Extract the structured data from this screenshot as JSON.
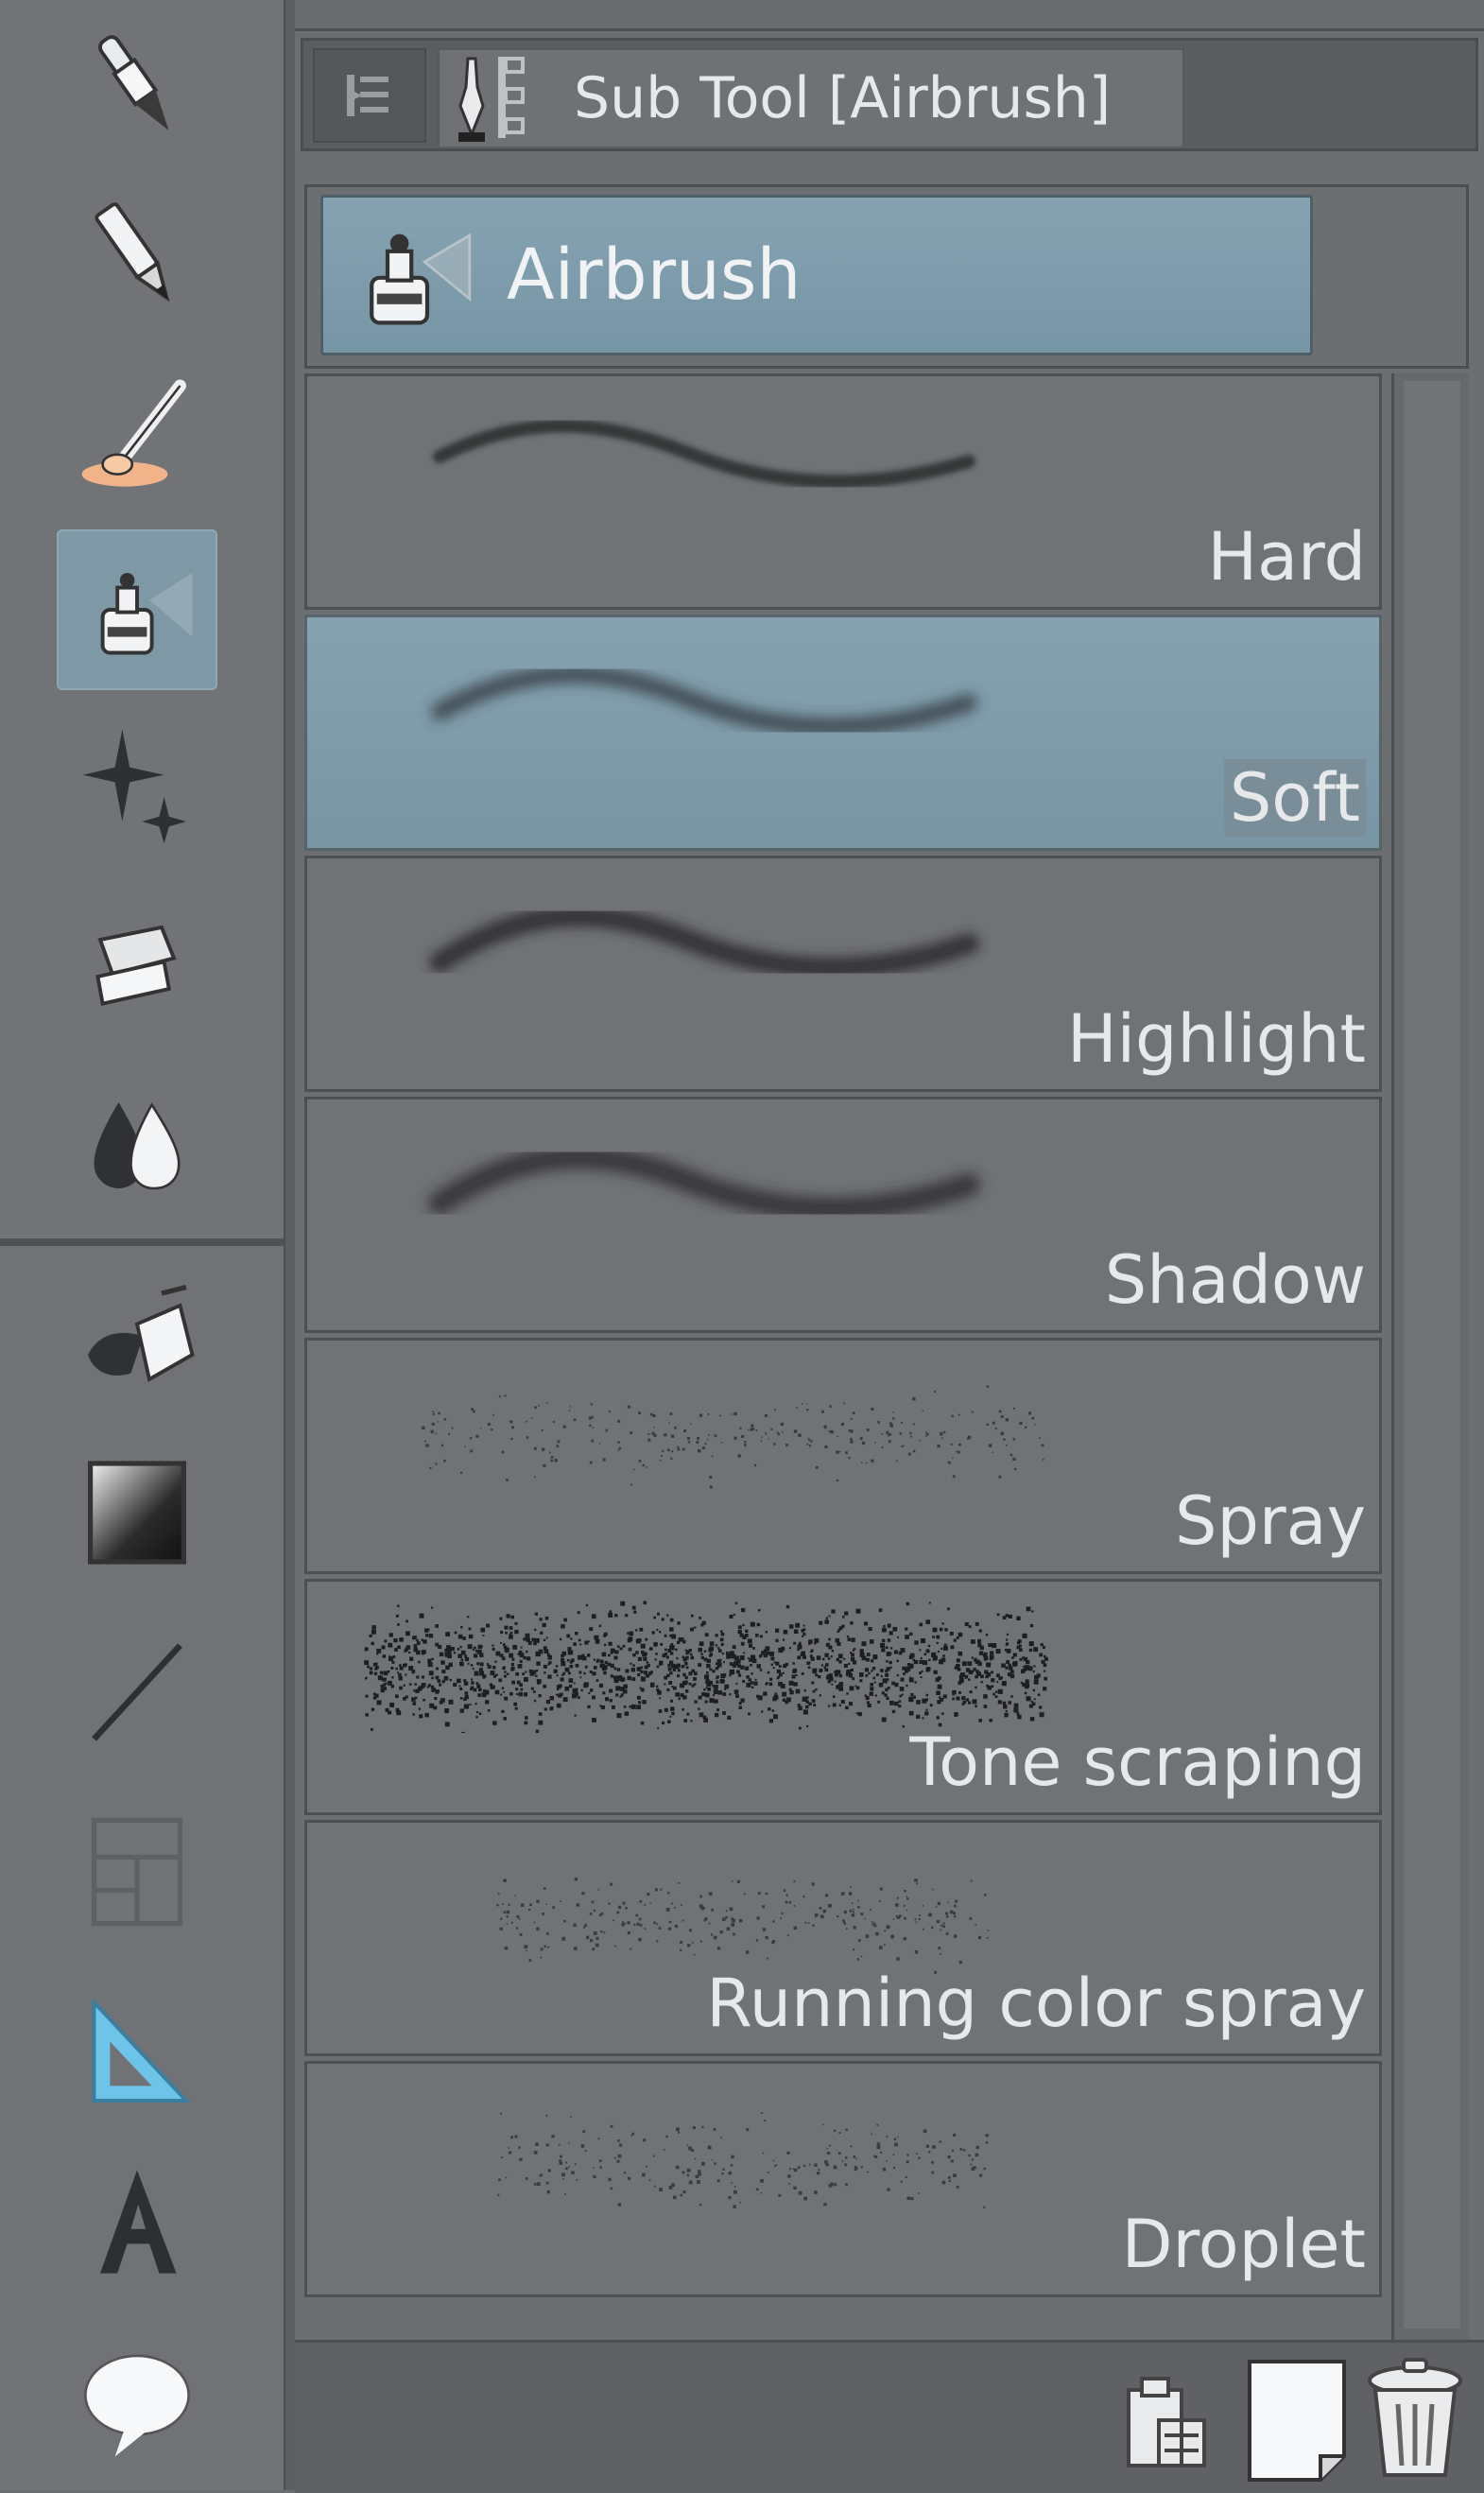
{
  "panel": {
    "tab_label": "Sub Tool [Airbrush]"
  },
  "group": {
    "label": "Airbrush"
  },
  "brushes": [
    {
      "label": "Hard"
    },
    {
      "label": "Soft"
    },
    {
      "label": "Highlight"
    },
    {
      "label": "Shadow"
    },
    {
      "label": "Spray"
    },
    {
      "label": "Tone scraping"
    },
    {
      "label": "Running color spray"
    },
    {
      "label": "Droplet"
    }
  ],
  "selected_brush": "Soft",
  "colors": {
    "accent": "#7f98a6",
    "panel_bg": "#6c6e71",
    "text": "#e6e8ea"
  },
  "tools": [
    {
      "icon": "pen-nib-icon"
    },
    {
      "icon": "pencil-icon"
    },
    {
      "icon": "brush-icon"
    },
    {
      "icon": "airbrush-icon"
    },
    {
      "icon": "sparkle-decoration-icon"
    },
    {
      "icon": "eraser-icon"
    },
    {
      "icon": "blend-drops-icon"
    },
    {
      "icon": "fill-bucket-icon"
    },
    {
      "icon": "gradient-icon"
    },
    {
      "icon": "line-figure-icon"
    },
    {
      "icon": "frame-border-icon"
    },
    {
      "icon": "ruler-icon"
    },
    {
      "icon": "text-icon"
    },
    {
      "icon": "balloon-icon"
    }
  ]
}
